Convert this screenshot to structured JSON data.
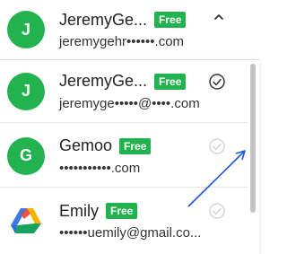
{
  "current_account": {
    "avatar_initial": "J",
    "name": "JeremyGe...",
    "badge": "Free",
    "email": "jeremygehr••••••.com"
  },
  "accounts": [
    {
      "avatar_initial": "J",
      "name": "JeremyGe...",
      "badge": "Free",
      "email": "jeremyge•••••@••••.com",
      "selected": true
    },
    {
      "avatar_initial": "G",
      "name": "Gemoo",
      "badge": "Free",
      "email": "•••••••••••.com",
      "selected": false
    },
    {
      "avatar_initial": "",
      "name": "Emily",
      "badge": "Free",
      "email": "••••••uemily@gmail.co...",
      "selected": false,
      "avatar_icon": "google-drive-style-logo"
    }
  ],
  "colors": {
    "avatar": "#22b34e",
    "badge": "#22b34e",
    "annotation_arrow": "#1a56db"
  }
}
